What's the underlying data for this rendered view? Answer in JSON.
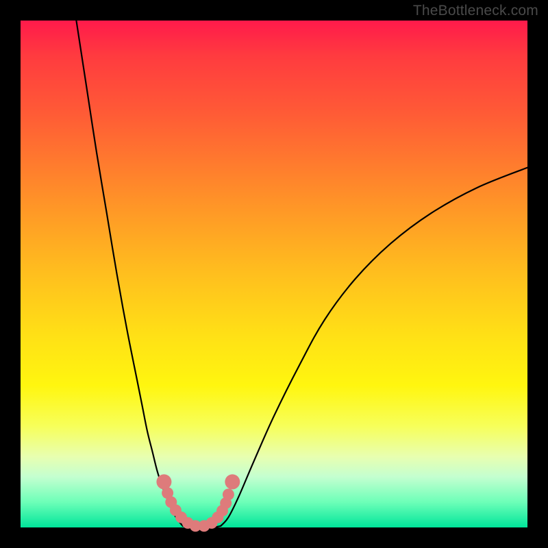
{
  "watermark": "TheBottleneck.com",
  "colors": {
    "background": "#000000",
    "watermark_text": "#4a4a4a",
    "curve": "#000000",
    "markers": "#de7b7b",
    "gradient_stops": [
      "#ff1a4b",
      "#ff3b3f",
      "#ff5a36",
      "#ff7a2e",
      "#ff9a26",
      "#ffbf1e",
      "#ffe016",
      "#fff60f",
      "#f7ff5a",
      "#e8ffb0",
      "#c4ffd0",
      "#6dffb8",
      "#00e59a"
    ]
  },
  "chart_data": {
    "type": "line",
    "title": "",
    "xlabel": "",
    "ylabel": "",
    "xlim": [
      0,
      100
    ],
    "ylim": [
      0,
      100
    ],
    "series": [
      {
        "name": "left-curve",
        "x": [
          11,
          13,
          15,
          17,
          19,
          21,
          23,
          24,
          25,
          26,
          27,
          28,
          29,
          30,
          31,
          32
        ],
        "y": [
          100,
          87,
          74,
          62,
          50,
          39,
          29,
          24,
          19,
          15,
          11,
          8,
          5.5,
          3.2,
          1.5,
          0.3
        ]
      },
      {
        "name": "valley-floor",
        "x": [
          32,
          33.5,
          35,
          36.5,
          38,
          39.5
        ],
        "y": [
          0.3,
          0.0,
          0.0,
          0.0,
          0.0,
          0.3
        ]
      },
      {
        "name": "right-curve",
        "x": [
          39.5,
          41,
          43,
          46,
          50,
          55,
          60,
          66,
          73,
          81,
          90,
          100
        ],
        "y": [
          0.3,
          2,
          6,
          13,
          22,
          32,
          41,
          49,
          56,
          62,
          67,
          71
        ]
      }
    ],
    "markers": {
      "name": "salmon-dots",
      "x": [
        29.0,
        29.7,
        30.6,
        31.7,
        33.0,
        34.5,
        36.2,
        37.7,
        38.9,
        39.8,
        40.5,
        41.0
      ],
      "y": [
        6.8,
        5.0,
        3.4,
        2.0,
        0.9,
        0.3,
        0.3,
        0.9,
        2.0,
        3.3,
        4.8,
        6.5
      ]
    },
    "marker_caps": {
      "left": {
        "x": 28.3,
        "y": 9.0
      },
      "right": {
        "x": 41.8,
        "y": 9.0
      }
    }
  }
}
